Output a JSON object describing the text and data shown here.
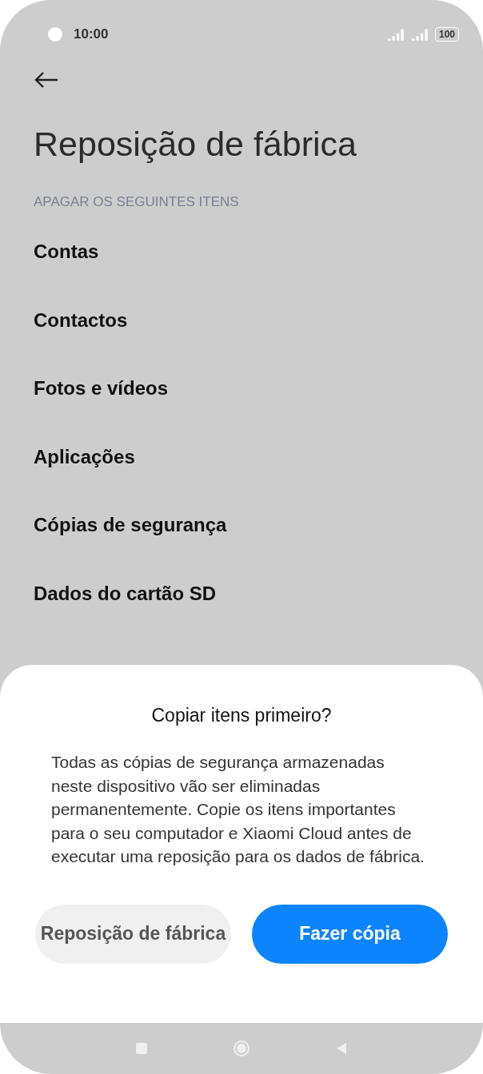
{
  "status_bar": {
    "time": "10:00",
    "battery": "100"
  },
  "page": {
    "title": "Reposição de fábrica",
    "section_header": "APAGAR OS SEGUINTES ITENS",
    "items": [
      "Contas",
      "Contactos",
      "Fotos e vídeos",
      "Aplicações",
      "Cópias de segurança",
      "Dados do cartão SD"
    ]
  },
  "dialog": {
    "title": "Copiar itens primeiro?",
    "message": "Todas as cópias de segurança armazenadas neste dispositivo vão ser eliminadas permanentemente. Copie os itens importantes para o seu computador e Xiaomi Cloud antes de executar uma reposição para os dados de fábrica.",
    "buttons": [
      {
        "label": "Reposição de fábrica",
        "kind": "secondary"
      },
      {
        "label": "Fazer cópia",
        "kind": "primary"
      }
    ]
  }
}
